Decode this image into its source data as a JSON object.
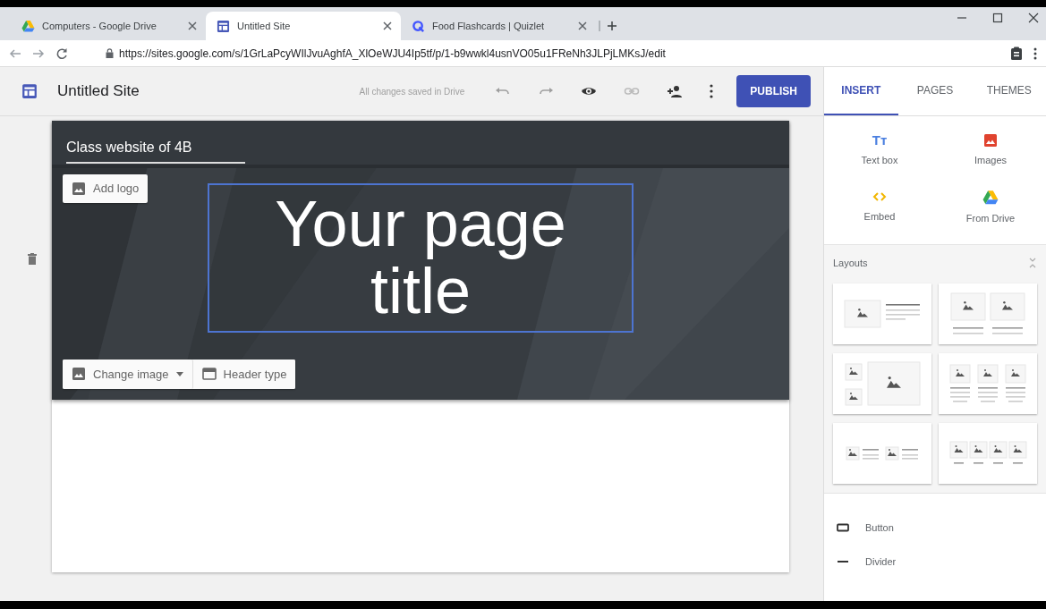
{
  "browser": {
    "tabs": [
      {
        "title": "Computers - Google Drive",
        "kind": "drive",
        "selected": false
      },
      {
        "title": "Untitled Site",
        "kind": "sites",
        "selected": true
      },
      {
        "title": "Food Flashcards | Quizlet",
        "kind": "quizlet",
        "selected": false
      }
    ],
    "url": "https://sites.google.com/s/1GrLaPcyWIlJvuAghfA_XlOeWJU4Ip5tf/p/1-b9wwkl4usnVO05u1FReNh3JLPjLMKsJ/edit"
  },
  "toolbar": {
    "site_name": "Untitled Site",
    "save_status": "All changes saved in Drive",
    "publish": "PUBLISH"
  },
  "panel_tabs": [
    {
      "label": "INSERT",
      "selected": true
    },
    {
      "label": "PAGES",
      "selected": false
    },
    {
      "label": "THEMES",
      "selected": false
    }
  ],
  "header": {
    "site_title": "Class website of 4B",
    "add_logo": "Add logo",
    "page_title": "Your page title",
    "change_image": "Change image",
    "header_type": "Header type"
  },
  "insert_items": [
    {
      "label": "Text box",
      "kind": "textbox",
      "icon_text": "Tт"
    },
    {
      "label": "Images",
      "kind": "images"
    },
    {
      "label": "Embed",
      "kind": "embed"
    },
    {
      "label": "From Drive",
      "kind": "drive"
    }
  ],
  "layouts": {
    "title": "Layouts",
    "expanded": true,
    "options": [
      {
        "kind": "image-text"
      },
      {
        "kind": "two-images"
      },
      {
        "kind": "image-mosaic"
      },
      {
        "kind": "three-images"
      },
      {
        "kind": "image-text-pair"
      },
      {
        "kind": "four-images"
      }
    ]
  },
  "components": [
    {
      "label": "Button",
      "kind": "button"
    },
    {
      "label": "Divider",
      "kind": "divider"
    }
  ]
}
